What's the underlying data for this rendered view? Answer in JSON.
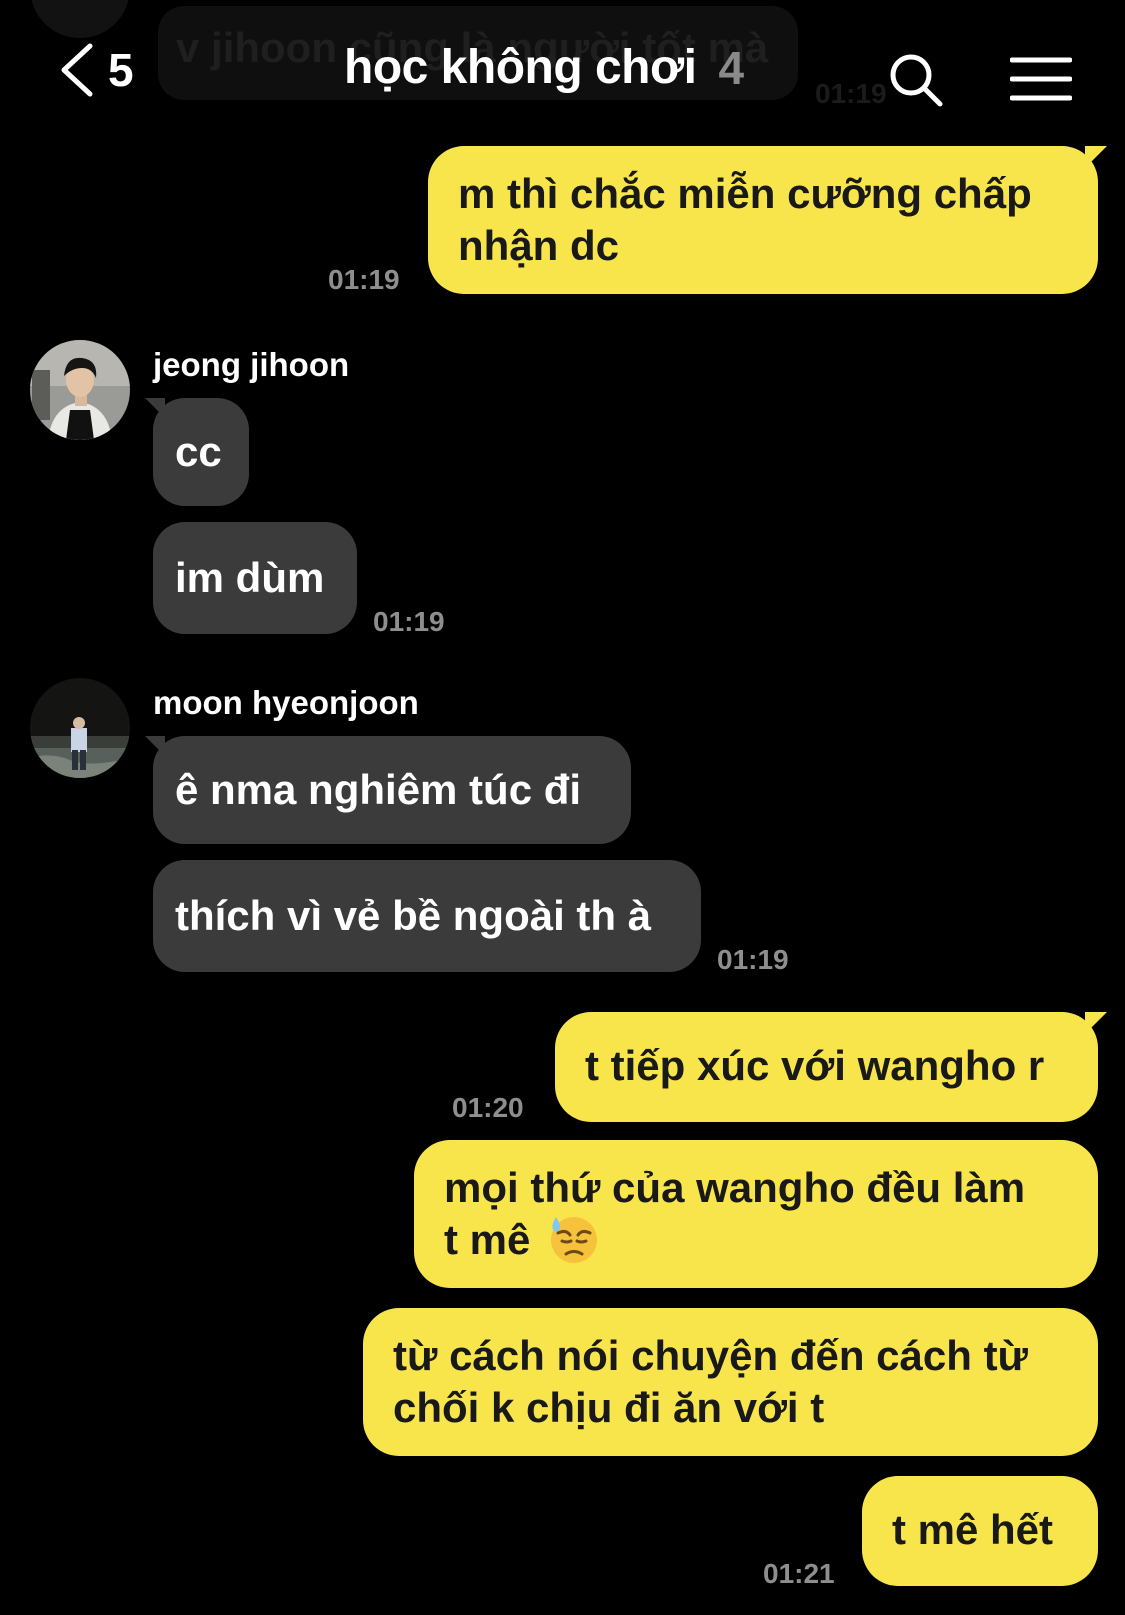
{
  "header": {
    "back_count": "5",
    "title": "học không chơi",
    "member_count": "4"
  },
  "ghost": {
    "text": "v jihoon cũng là người tốt mà",
    "time": "01:19"
  },
  "messages": [
    {
      "sender": "me",
      "lines": [
        "m thì chắc miễn cưỡng chấp",
        "nhận dc"
      ],
      "time": "01:19"
    },
    {
      "sender": "jeong jihoon",
      "text": "cc"
    },
    {
      "sender": "jeong jihoon",
      "text": "im dùm",
      "time": "01:19"
    },
    {
      "sender": "moon hyeonjoon",
      "text": "ê nma nghiêm túc đi"
    },
    {
      "sender": "moon hyeonjoon",
      "text": "thích vì vẻ bề ngoài th à",
      "time": "01:19"
    },
    {
      "sender": "me",
      "text": "t tiếp xúc với wangho r",
      "time": "01:20"
    },
    {
      "sender": "me",
      "lines": [
        "mọi thứ của wangho đều làm",
        "t mê"
      ],
      "emoji": "downcast-face-with-sweat"
    },
    {
      "sender": "me",
      "lines": [
        "từ cách nói chuyện đến cách từ",
        "chối k chịu đi ăn với t"
      ]
    },
    {
      "sender": "me",
      "text": "t mê hết",
      "time": "01:21"
    }
  ],
  "icons": {
    "back": "chevron-left-icon",
    "search": "search-icon",
    "menu": "menu-icon"
  },
  "colors": {
    "background": "#000000",
    "my_bubble": "#f8e54c",
    "their_bubble": "#3b3b3c",
    "timestamp": "#8e8e8e"
  }
}
